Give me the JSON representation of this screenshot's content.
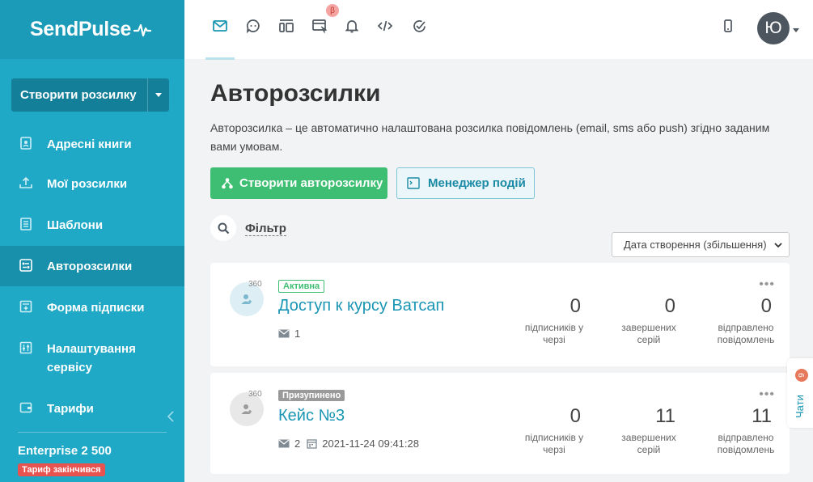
{
  "brand": {
    "name": "SendPulse"
  },
  "sidebar": {
    "create_button": "Створити розсилку",
    "items": [
      {
        "label": "Адресні книги",
        "icon": "address-book-icon"
      },
      {
        "label": "Мої розсилки",
        "icon": "upload-icon"
      },
      {
        "label": "Шаблони",
        "icon": "templates-icon"
      },
      {
        "label": "Авторозсилки",
        "icon": "automation-icon"
      },
      {
        "label": "Форма підписки",
        "icon": "form-icon"
      },
      {
        "label": "Налаштування сервісу",
        "icon": "settings-icon"
      },
      {
        "label": "Тарифи",
        "icon": "wallet-icon"
      }
    ],
    "active_index": 3,
    "plan_name": "Enterprise 2 500",
    "plan_status": "Тариф закінчився"
  },
  "topbar": {
    "icons": [
      "email-icon",
      "chat-icon",
      "push-icon",
      "crm-icon",
      "bell-icon",
      "code-icon",
      "check-icon"
    ],
    "beta_badge": "β",
    "avatar_initial": "Ю"
  },
  "main": {
    "title": "Авторозсилки",
    "description": "Авторозсилка – це автоматично налаштована розсилка повідомлень (email, sms або push) згідно заданим вами умовам.",
    "create_button": "Створити авторозсилку",
    "events_button": "Менеджер подій",
    "filter_label": "Фільтр",
    "sort_value": "Дата створення (збільшення)"
  },
  "cards": [
    {
      "badge_number": "360",
      "status": "Активна",
      "title": "Доступ к курсу Ватсап",
      "messages": "1",
      "date": "",
      "stats": [
        {
          "value": "0",
          "label": "підписників у черзі"
        },
        {
          "value": "0",
          "label": "завершених серій"
        },
        {
          "value": "0",
          "label": "відправлено повідомлень"
        }
      ]
    },
    {
      "badge_number": "360",
      "status": "Призупинено",
      "title": "Кейс №3",
      "messages": "2",
      "date": "2021-11-24 09:41:28",
      "stats": [
        {
          "value": "0",
          "label": "підписників у черзі"
        },
        {
          "value": "11",
          "label": "завершених серій"
        },
        {
          "value": "11",
          "label": "відправлено повідомлень"
        }
      ]
    }
  ],
  "chat_widget": {
    "label": "Чати",
    "count": "9"
  },
  "colors": {
    "sidebar": "#1fa9c6",
    "accent": "#1a96b4",
    "green": "#3dbe72",
    "danger": "#e8524f"
  }
}
